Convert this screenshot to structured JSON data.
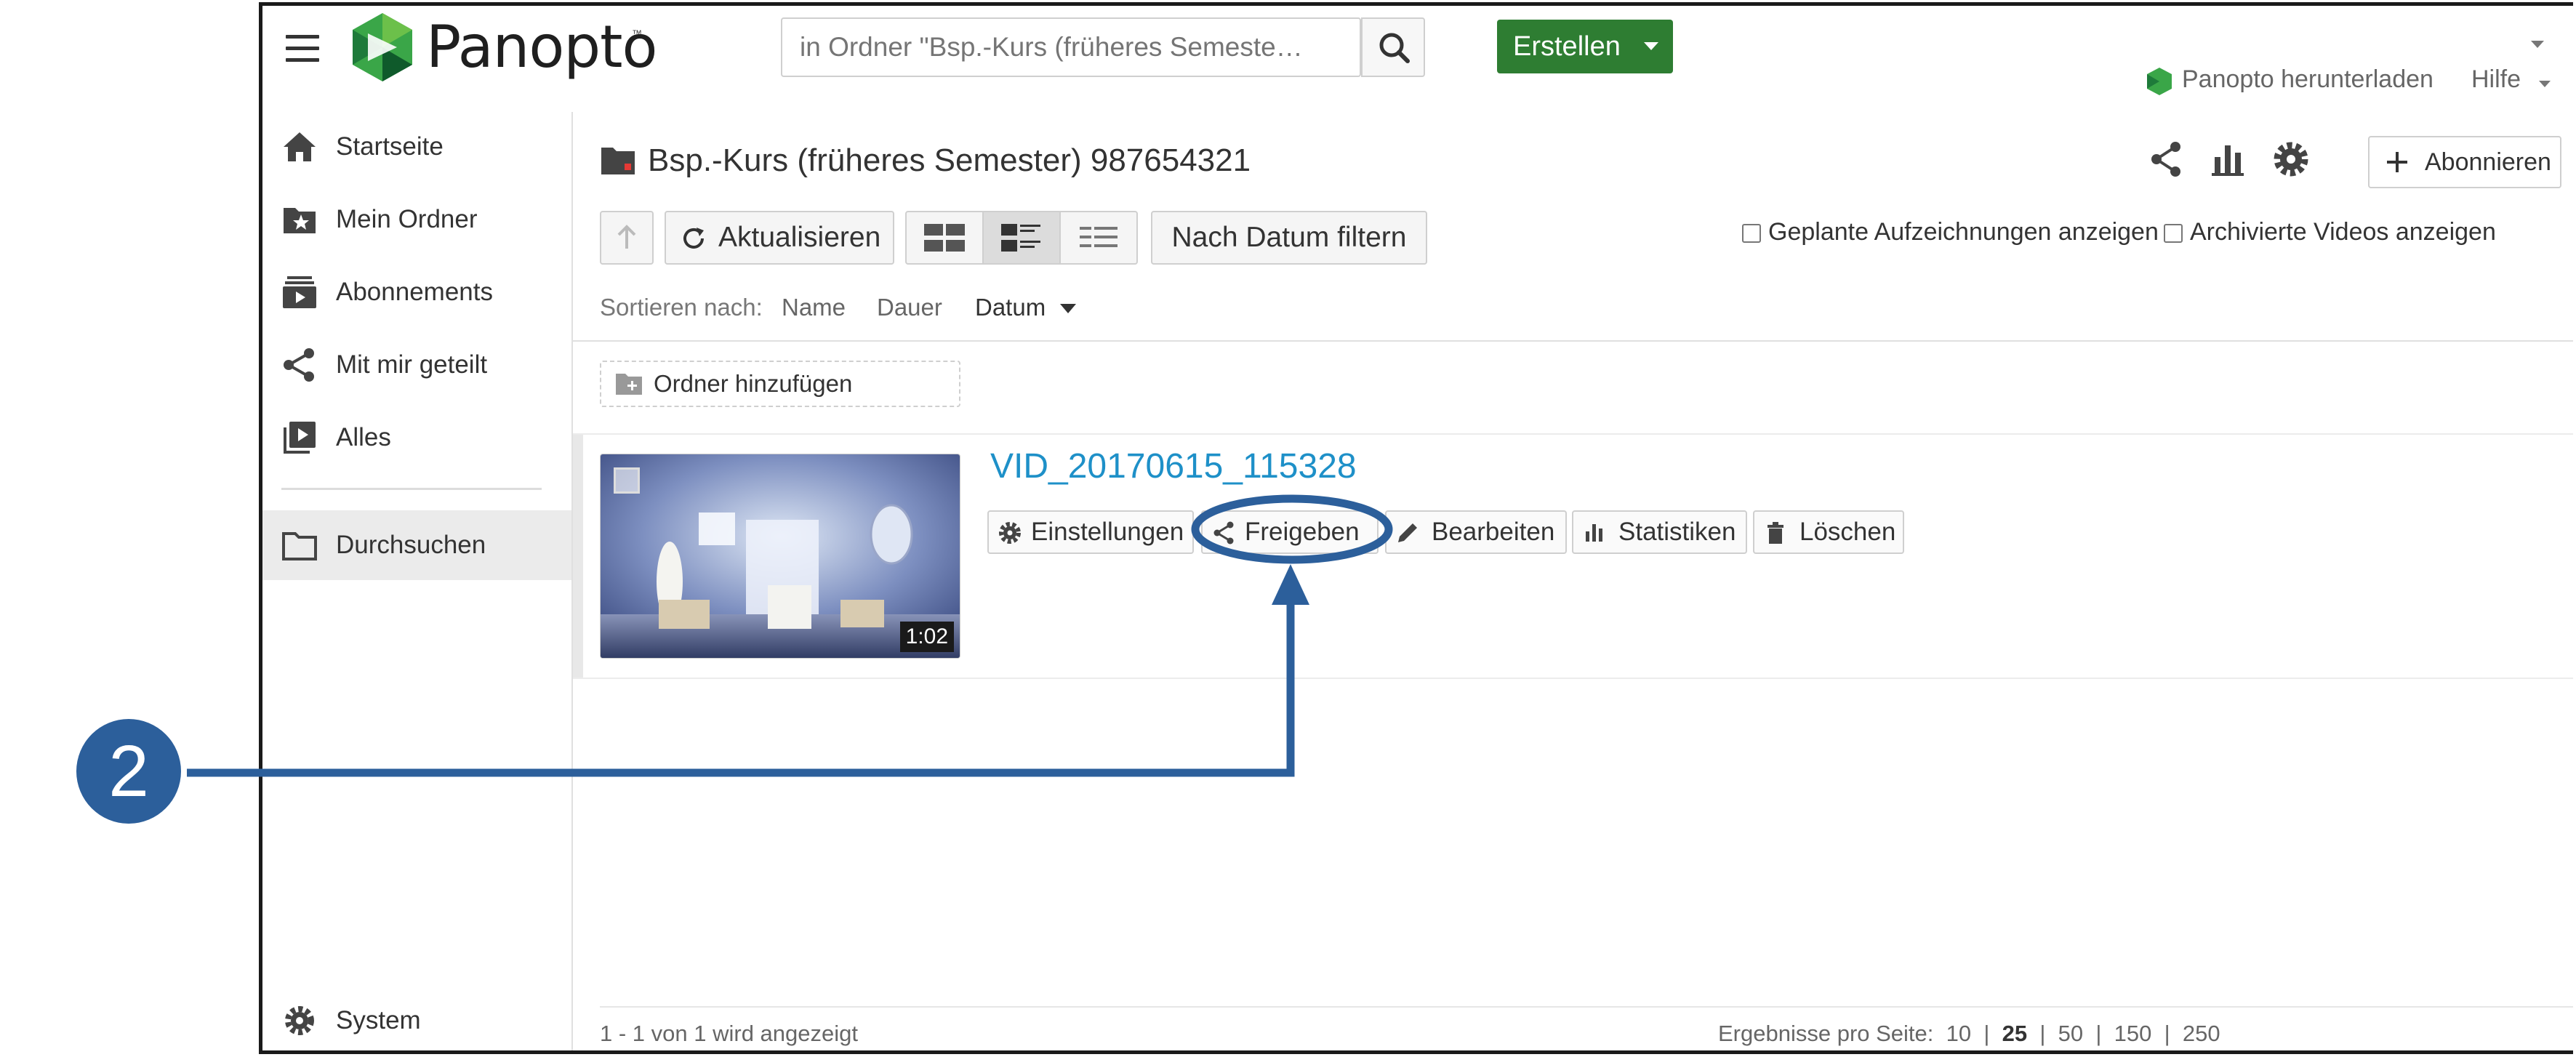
{
  "app": {
    "logo_text": "Panopto",
    "logo_tm": "™"
  },
  "search": {
    "placeholder": "in Ordner \"Bsp.-Kurs (früheres Semeste…"
  },
  "header": {
    "create_label": "Erstellen",
    "download_label": "Panopto herunterladen",
    "help_label": "Hilfe"
  },
  "sidebar": {
    "items": [
      {
        "label": "Startseite",
        "icon": "home-icon"
      },
      {
        "label": "Mein Ordner",
        "icon": "star-folder-icon"
      },
      {
        "label": "Abonnements",
        "icon": "subscriptions-icon"
      },
      {
        "label": "Mit mir geteilt",
        "icon": "share-icon"
      },
      {
        "label": "Alles",
        "icon": "video-library-icon"
      },
      {
        "label": "Durchsuchen",
        "icon": "folder-icon",
        "active": true
      },
      {
        "label": "System",
        "icon": "gear-icon"
      }
    ]
  },
  "folder": {
    "title": "Bsp.-Kurs (früheres Semester) 987654321",
    "subscribe_label": "Abonnieren"
  },
  "toolbar": {
    "refresh_label": "Aktualisieren",
    "date_filter_label": "Nach Datum filtern",
    "scheduled_label": "Geplante Aufzeichnungen anzeigen",
    "archived_label": "Archivierte Videos anzeigen"
  },
  "sort": {
    "label": "Sortieren nach:",
    "options": [
      "Name",
      "Dauer",
      "Datum"
    ],
    "active": "Datum"
  },
  "add_folder_label": "Ordner hinzufügen",
  "videos": [
    {
      "title": "VID_20170615_115328",
      "duration": "1:02",
      "actions": [
        "Einstellungen",
        "Freigeben",
        "Bearbeiten",
        "Statistiken",
        "Löschen"
      ]
    }
  ],
  "footer": {
    "count_text": "1 - 1 von 1 wird angezeigt",
    "per_page_label": "Ergebnisse pro Seite:",
    "page_sizes": [
      "10",
      "25",
      "50",
      "150",
      "250"
    ],
    "active_page_size": "25"
  },
  "annotation": {
    "step_number": "2",
    "color": "#2c5f9b"
  },
  "colors": {
    "brand_green": "#2e7d32",
    "link_blue": "#1e90c8"
  }
}
